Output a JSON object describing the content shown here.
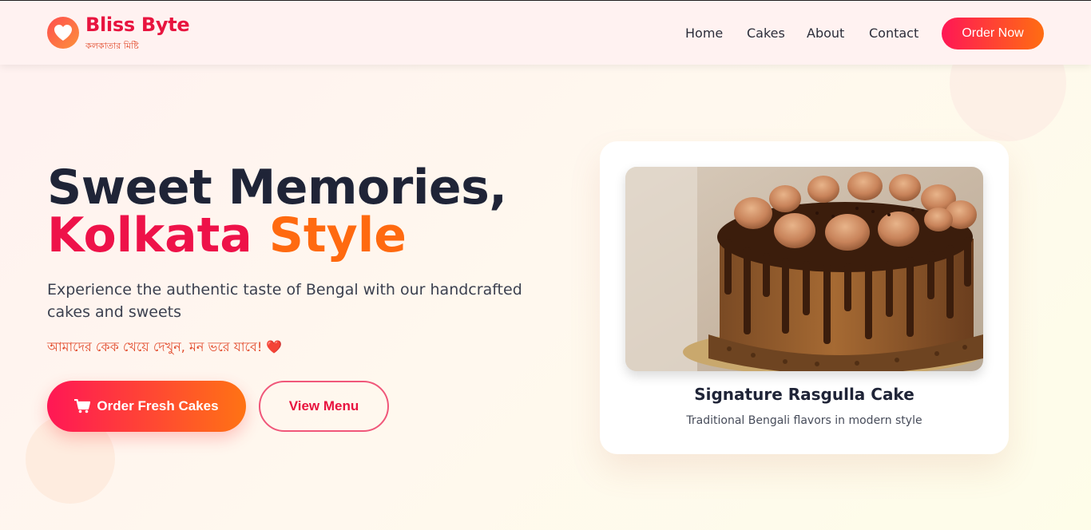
{
  "brand": {
    "name": "Bliss Byte",
    "tagline": "কলকাতার মিষ্টি",
    "logo_icon": "heart-icon",
    "accent": "#e8143f",
    "gradient_start": "#ff1755",
    "gradient_end": "#ff6d12"
  },
  "nav": {
    "items": [
      {
        "label": "Home"
      },
      {
        "label": "Cakes"
      },
      {
        "label": "About"
      },
      {
        "label": "Contact"
      }
    ],
    "cta_label": "Order Now"
  },
  "hero": {
    "title_line1": "Sweet Memories,",
    "title_word_a": "Kolkata",
    "title_word_b": "Style",
    "subtitle": "Experience the authentic taste of Bengal with our handcrafted cakes and sweets",
    "bengali_line": "আমাদের কেক খেয়ে দেখুন, মন ভরে যাবে!",
    "bengali_emoji": "❤️",
    "primary_button": {
      "label": "Order Fresh Cakes",
      "icon": "cart-icon"
    },
    "secondary_button": {
      "label": "View Menu"
    }
  },
  "featured": {
    "title": "Signature Rasgulla Cake",
    "description": "Traditional Bengali flavors in modern style",
    "image": "chocolate-drip-cake-image"
  }
}
